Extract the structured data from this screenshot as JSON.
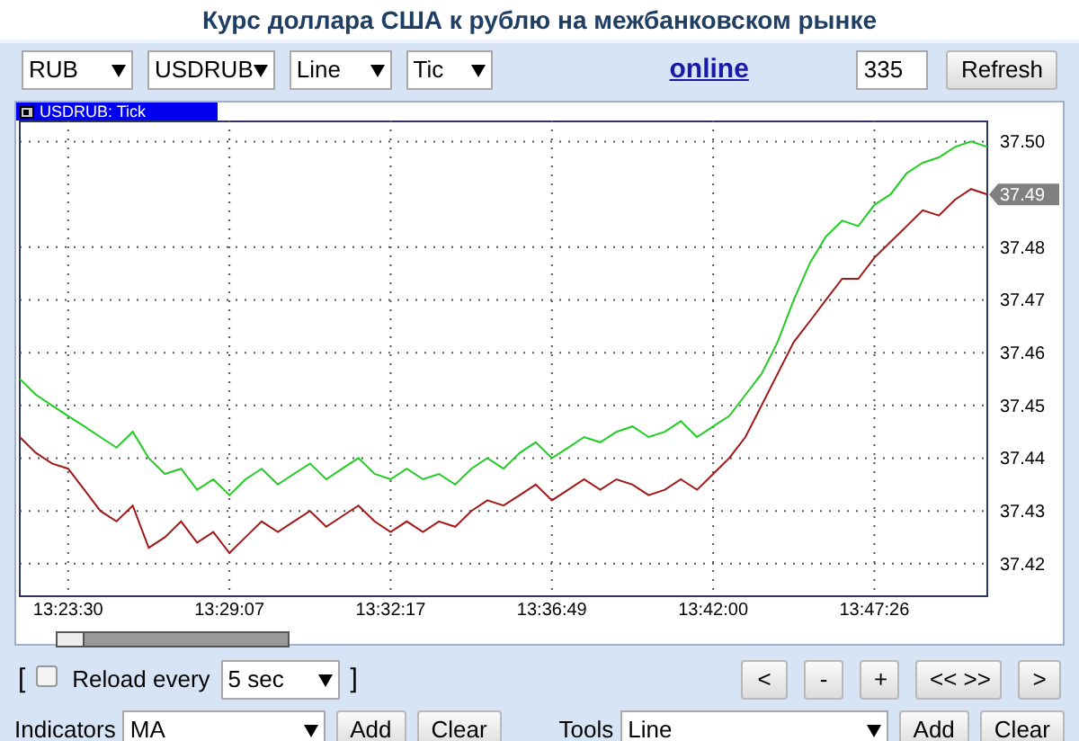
{
  "title": "Курс доллара США к рублю на межбанковском рынке",
  "toolbar": {
    "selects": [
      "RUB",
      "USDRUB",
      "Line",
      "Tic"
    ],
    "link": "online",
    "count": "335",
    "refresh": "Refresh"
  },
  "chart": {
    "price_tag": "37.49",
    "chart_data": {
      "type": "line",
      "title": "USDRUB: Tick",
      "grid": true,
      "ylim": [
        37.414,
        37.504
      ],
      "categories": [
        null,
        null,
        null,
        "13:23:30",
        null,
        null,
        null,
        null,
        null,
        null,
        null,
        null,
        null,
        "13:29:07",
        null,
        null,
        null,
        null,
        null,
        null,
        null,
        null,
        null,
        "13:32:17",
        null,
        null,
        null,
        null,
        null,
        null,
        null,
        null,
        null,
        "13:36:49",
        null,
        null,
        null,
        null,
        null,
        null,
        null,
        null,
        null,
        "13:42:00",
        null,
        null,
        null,
        null,
        null,
        null,
        null,
        null,
        null,
        "13:47:26",
        null,
        null,
        null,
        null,
        null,
        null,
        null
      ],
      "yticks": [
        {
          "value": 37.42,
          "label": "37.42"
        },
        {
          "value": 37.43,
          "label": "37.43"
        },
        {
          "value": 37.44,
          "label": "37.44"
        },
        {
          "value": 37.45,
          "label": "37.45"
        },
        {
          "value": 37.46,
          "label": "37.46"
        },
        {
          "value": 37.47,
          "label": "37.47"
        },
        {
          "value": 37.48,
          "label": "37.48"
        },
        {
          "value": 37.5,
          "label": "37.50"
        }
      ],
      "series": [
        {
          "color": "#22cc22",
          "values": [
            37.455,
            37.452,
            37.45,
            37.448,
            37.446,
            37.444,
            37.442,
            37.445,
            37.44,
            37.437,
            37.438,
            37.434,
            37.436,
            37.433,
            37.436,
            37.438,
            37.435,
            37.437,
            37.439,
            37.436,
            37.438,
            37.44,
            37.437,
            37.436,
            37.438,
            37.436,
            37.437,
            37.435,
            37.438,
            37.44,
            37.438,
            37.441,
            37.443,
            37.44,
            37.442,
            37.444,
            37.443,
            37.445,
            37.446,
            37.444,
            37.445,
            37.447,
            37.444,
            37.446,
            37.448,
            37.452,
            37.456,
            37.462,
            37.47,
            37.477,
            37.482,
            37.485,
            37.484,
            37.488,
            37.49,
            37.494,
            37.496,
            37.497,
            37.499,
            37.5,
            37.499
          ]
        },
        {
          "color": "#a01818",
          "values": [
            37.444,
            37.441,
            37.439,
            37.438,
            37.434,
            37.43,
            37.428,
            37.431,
            37.423,
            37.425,
            37.428,
            37.424,
            37.426,
            37.422,
            37.425,
            37.428,
            37.426,
            37.428,
            37.43,
            37.427,
            37.429,
            37.431,
            37.428,
            37.426,
            37.428,
            37.426,
            37.428,
            37.427,
            37.43,
            37.432,
            37.431,
            37.433,
            37.435,
            37.432,
            37.434,
            37.436,
            37.434,
            37.436,
            37.435,
            37.433,
            37.434,
            37.436,
            37.434,
            37.437,
            37.44,
            37.444,
            37.45,
            37.456,
            37.462,
            37.466,
            37.47,
            37.474,
            37.474,
            37.478,
            37.481,
            37.484,
            37.487,
            37.486,
            37.489,
            37.491,
            37.49
          ]
        }
      ]
    }
  },
  "reload": {
    "open": "[",
    "checked": false,
    "label": "Reload every",
    "interval": "5 sec",
    "close": "]"
  },
  "nav_buttons": [
    "<",
    "-",
    "+",
    "<< >>",
    ">"
  ],
  "indicators": {
    "label": "Indicators",
    "value": "MA",
    "add": "Add",
    "clear": "Clear"
  },
  "tools": {
    "label": "Tools",
    "value": "Line",
    "add": "Add",
    "clear": "Clear"
  }
}
